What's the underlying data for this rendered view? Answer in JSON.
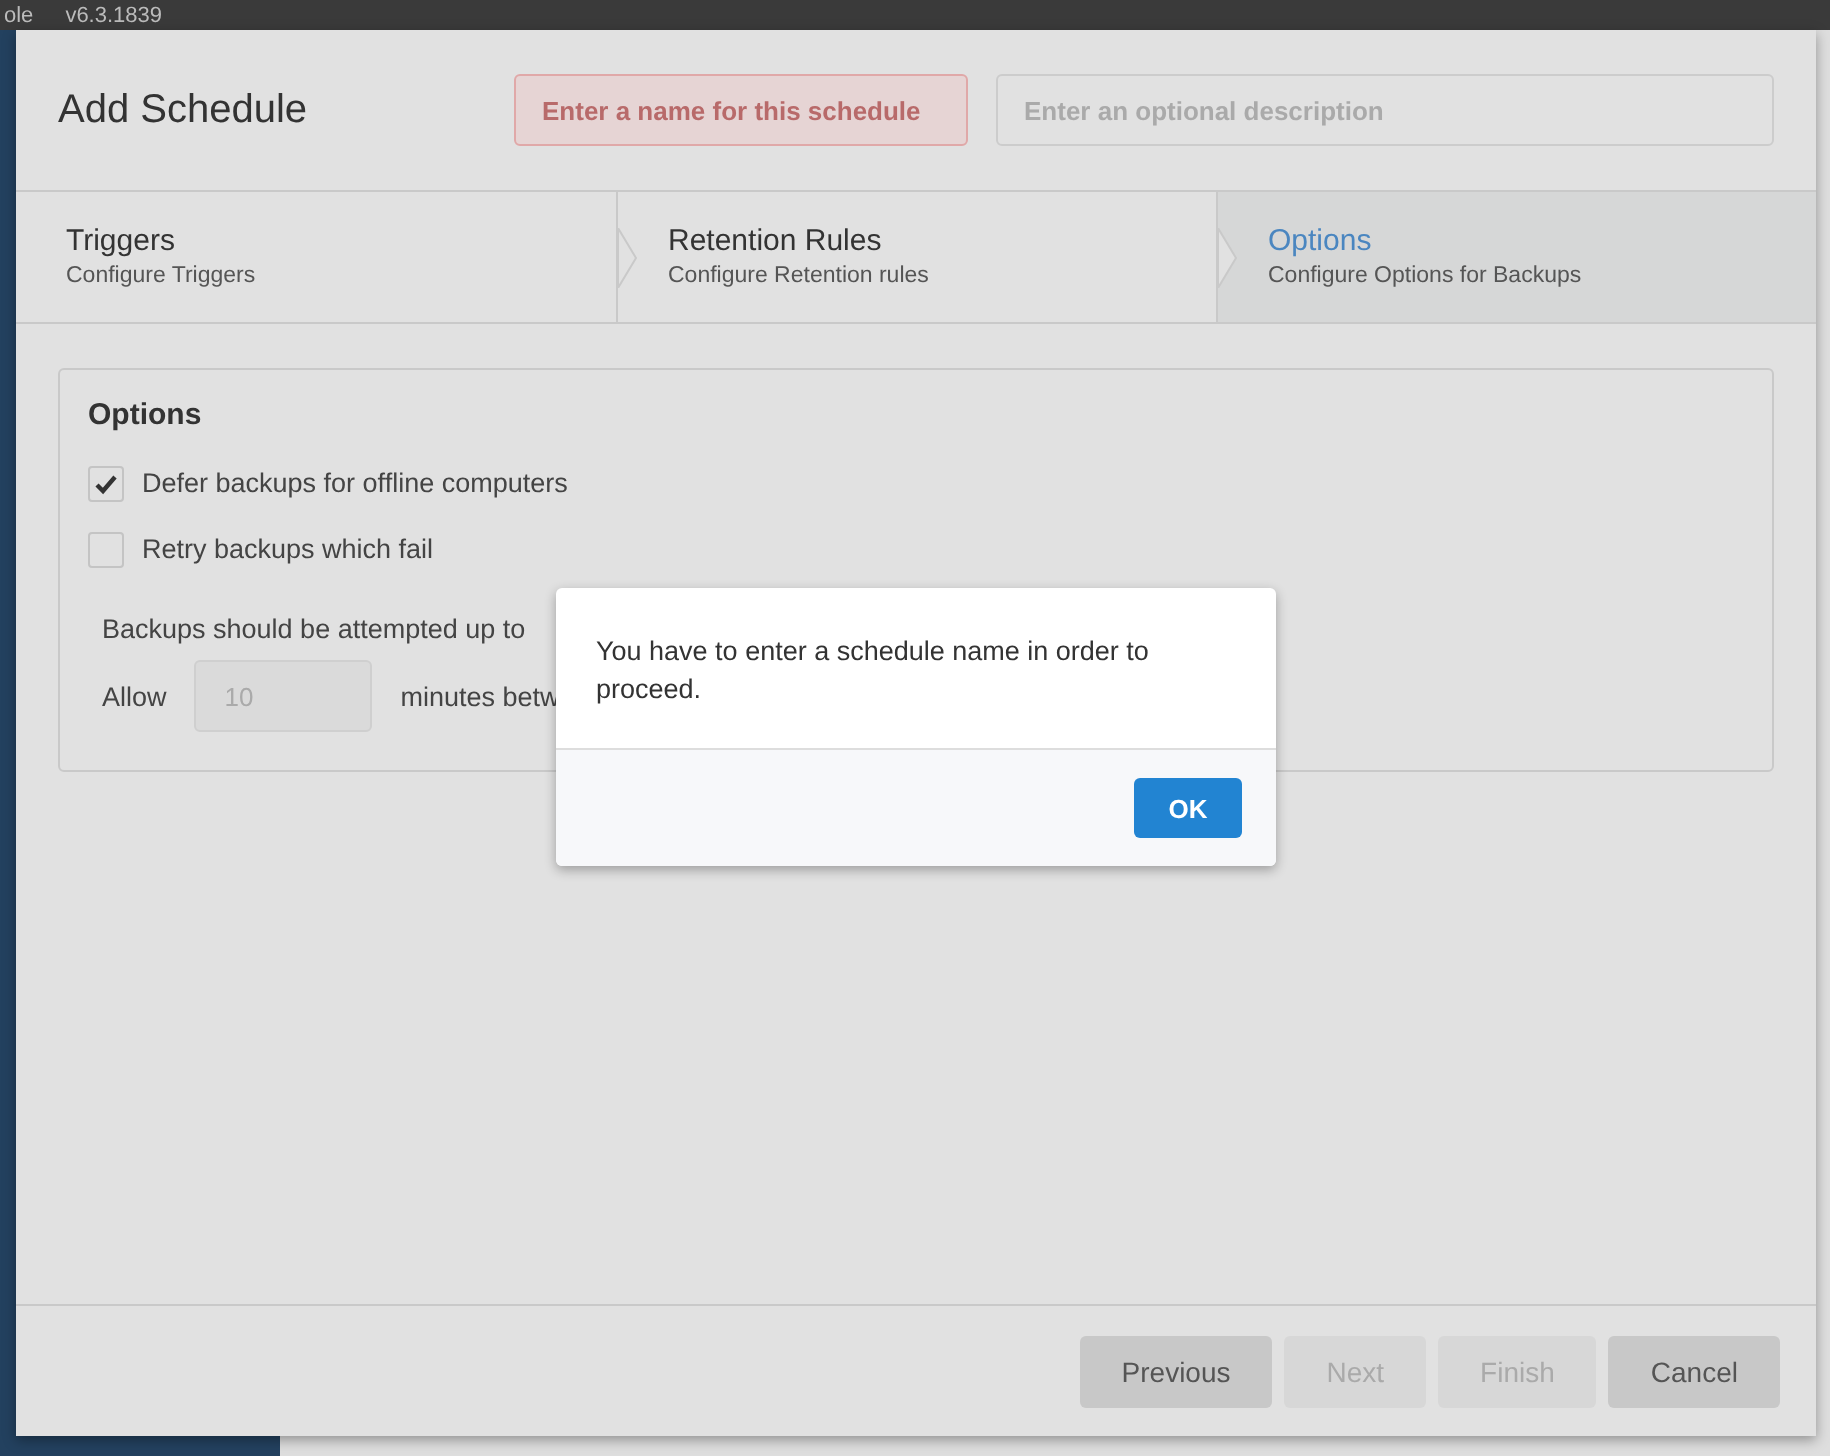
{
  "app": {
    "title_fragment": "ole",
    "version": "v6.3.1839"
  },
  "dialog": {
    "title": "Add Schedule",
    "name_field": {
      "placeholder": "Enter a name for this schedule",
      "invalid": true
    },
    "description_field": {
      "placeholder": "Enter an optional description",
      "invalid": false
    },
    "steps": [
      {
        "title": "Triggers",
        "subtitle": "Configure Triggers",
        "selected": false
      },
      {
        "title": "Retention Rules",
        "subtitle": "Configure Retention rules",
        "selected": false
      },
      {
        "title": "Options",
        "subtitle": "Configure Options for Backups",
        "selected": true
      }
    ],
    "options": {
      "heading": "Options",
      "checkboxes": [
        {
          "label": "Defer backups for offline computers",
          "checked": true
        },
        {
          "label": "Retry backups which fail",
          "checked": false
        }
      ],
      "attempts_text": "Backups should be attempted up to",
      "allow_label": "Allow",
      "allow_value": "10",
      "minutes_text": "minutes betw"
    },
    "buttons": [
      {
        "label": "Previous",
        "disabled": false
      },
      {
        "label": "Next",
        "disabled": true
      },
      {
        "label": "Finish",
        "disabled": true
      },
      {
        "label": "Cancel",
        "disabled": false
      }
    ]
  },
  "alert": {
    "message": "You have to enter a schedule name in order to proceed.",
    "button": "OK"
  }
}
